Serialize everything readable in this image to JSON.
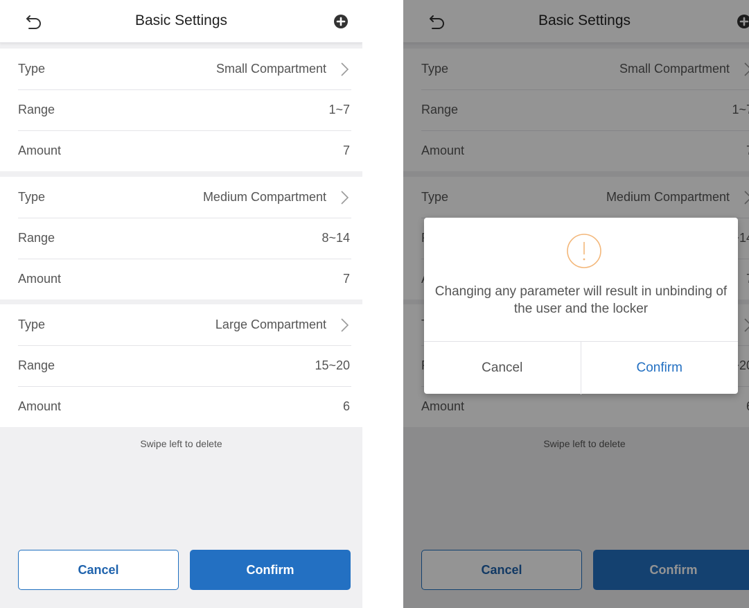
{
  "header": {
    "title": "Basic Settings",
    "back_icon": "back-arrow-icon",
    "add_icon": "plus-circle-icon"
  },
  "compartments": [
    {
      "type_label": "Type",
      "type_value": "Small Compartment",
      "range_label": "Range",
      "range_value": "1~7",
      "amount_label": "Amount",
      "amount_value": "7"
    },
    {
      "type_label": "Type",
      "type_value": "Medium Compartment",
      "range_label": "Range",
      "range_value": "8~14",
      "amount_label": "Amount",
      "amount_value": "7"
    },
    {
      "type_label": "Type",
      "type_value": "Large Compartment",
      "range_label": "Range",
      "range_value": "15~20",
      "amount_label": "Amount",
      "amount_value": "6"
    }
  ],
  "hint": "Swipe left to delete",
  "footer": {
    "cancel_label": "Cancel",
    "confirm_label": "Confirm"
  },
  "dialog": {
    "icon": "warning-circle-icon",
    "message": "Changing any parameter will result in unbinding of the user and the locker",
    "cancel_label": "Cancel",
    "confirm_label": "Confirm"
  },
  "colors": {
    "accent": "#2370c2",
    "warning": "#f3b77a",
    "overlay": "rgba(0,0,0,0.42)"
  }
}
